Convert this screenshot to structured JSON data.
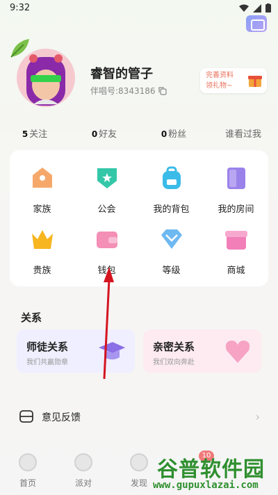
{
  "statusbar": {
    "time": "9:32"
  },
  "profile": {
    "name": "睿智的管子",
    "id_label": "伴唱号:8343186",
    "gift": {
      "line1": "完善资料",
      "line2": "领礼物~"
    }
  },
  "stats": [
    {
      "count": "5",
      "label": "关注"
    },
    {
      "count": "0",
      "label": "好友"
    },
    {
      "count": "0",
      "label": "粉丝"
    },
    {
      "count": "",
      "label": "谁看过我"
    }
  ],
  "grid": [
    {
      "label": "家族",
      "icon": "family-icon",
      "color": "#f6a86a"
    },
    {
      "label": "公会",
      "icon": "guild-icon",
      "color": "#33c7a8"
    },
    {
      "label": "我的背包",
      "icon": "backpack-icon",
      "color": "#3bbbe8"
    },
    {
      "label": "我的房间",
      "icon": "room-icon",
      "color": "#9a82ea"
    },
    {
      "label": "贵族",
      "icon": "crown-icon",
      "color": "#f7b51f"
    },
    {
      "label": "钱包",
      "icon": "wallet-icon",
      "color": "#f48fb6"
    },
    {
      "label": "等级",
      "icon": "diamond-icon",
      "color": "#6fb9f2"
    },
    {
      "label": "商城",
      "icon": "shop-icon",
      "color": "#f27fb8"
    }
  ],
  "relations": {
    "title": "关系",
    "items": [
      {
        "title": "师徒关系",
        "subtitle": "我们共赢勋章",
        "bg": "#efefff"
      },
      {
        "title": "亲密关系",
        "subtitle": "我们双向奔赴",
        "bg": "#fdebf1"
      }
    ]
  },
  "feedback": {
    "label": "意见反馈"
  },
  "tabs": [
    {
      "label": "首页"
    },
    {
      "label": "派对"
    },
    {
      "label": "发现"
    }
  ],
  "badge": "10",
  "watermark": {
    "line1": "谷普软件园",
    "line2": "www.gupuxlazai.com"
  },
  "colors": {
    "arrow": "#d4141f",
    "accent": "#e8705b"
  }
}
